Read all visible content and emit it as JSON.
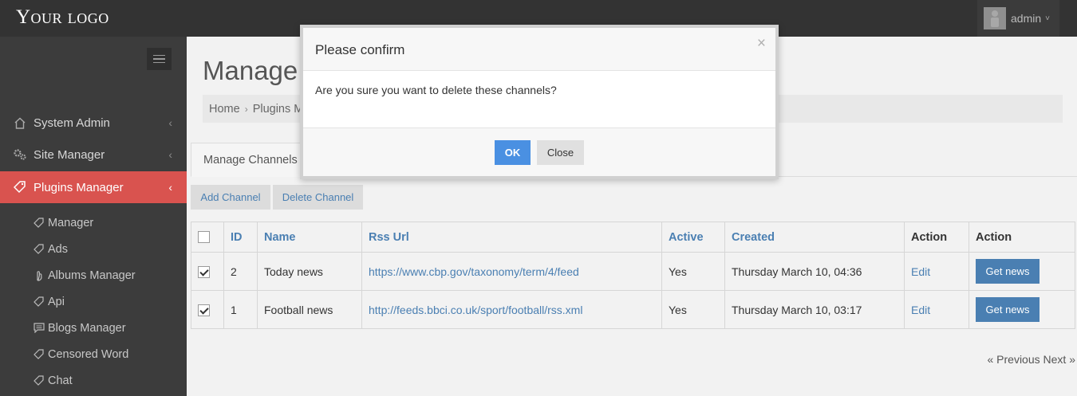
{
  "header": {
    "logo": "Your logo",
    "user_name": "admin",
    "user_caret": "˅"
  },
  "sidebar": {
    "items": [
      {
        "label": "System Admin",
        "icon": "home-icon",
        "chevron": "‹"
      },
      {
        "label": "Site Manager",
        "icon": "gears-icon",
        "chevron": "‹"
      },
      {
        "label": "Plugins Manager",
        "icon": "tags-icon",
        "chevron": "‹",
        "active": true
      }
    ],
    "subitems": [
      {
        "label": "Manager",
        "icon": "tag-icon"
      },
      {
        "label": "Ads",
        "icon": "tag-icon"
      },
      {
        "label": "Albums Manager",
        "icon": "hand-icon"
      },
      {
        "label": "Api",
        "icon": "tag-icon"
      },
      {
        "label": "Blogs Manager",
        "icon": "comment-icon"
      },
      {
        "label": "Censored Word",
        "icon": "tag-icon"
      },
      {
        "label": "Chat",
        "icon": "tag-icon"
      }
    ]
  },
  "main": {
    "title": "Manage C",
    "breadcrumb": [
      "Home",
      "Plugins M"
    ],
    "breadcrumb_sep": "›",
    "tab": "Manage Channels",
    "buttons": {
      "add": "Add Channel",
      "delete": "Delete Channel"
    },
    "table": {
      "headers": [
        "ID",
        "Name",
        "Rss Url",
        "Active",
        "Created",
        "Action",
        "Action"
      ],
      "rows": [
        {
          "checked": true,
          "id": "2",
          "name": "Today news",
          "url": "https://www.cbp.gov/taxonomy/term/4/feed",
          "active": "Yes",
          "created": "Thursday March 10, 04:36",
          "edit": "Edit",
          "get": "Get news"
        },
        {
          "checked": true,
          "id": "1",
          "name": "Football news",
          "url": "http://feeds.bbci.co.uk/sport/football/rss.xml",
          "active": "Yes",
          "created": "Thursday March 10, 03:17",
          "edit": "Edit",
          "get": "Get news"
        }
      ]
    },
    "pager": {
      "previous": "« Previous",
      "next": "Next »"
    }
  },
  "modal": {
    "title": "Please confirm",
    "close_glyph": "×",
    "message": "Are you sure you want to delete these channels?",
    "ok": "OK",
    "close": "Close"
  },
  "colors": {
    "topbar": "#333333",
    "sidebar": "#3c3c3c",
    "active_nav": "#d9534f",
    "link": "#4a7fb2",
    "ok_button": "#4a90e2"
  }
}
